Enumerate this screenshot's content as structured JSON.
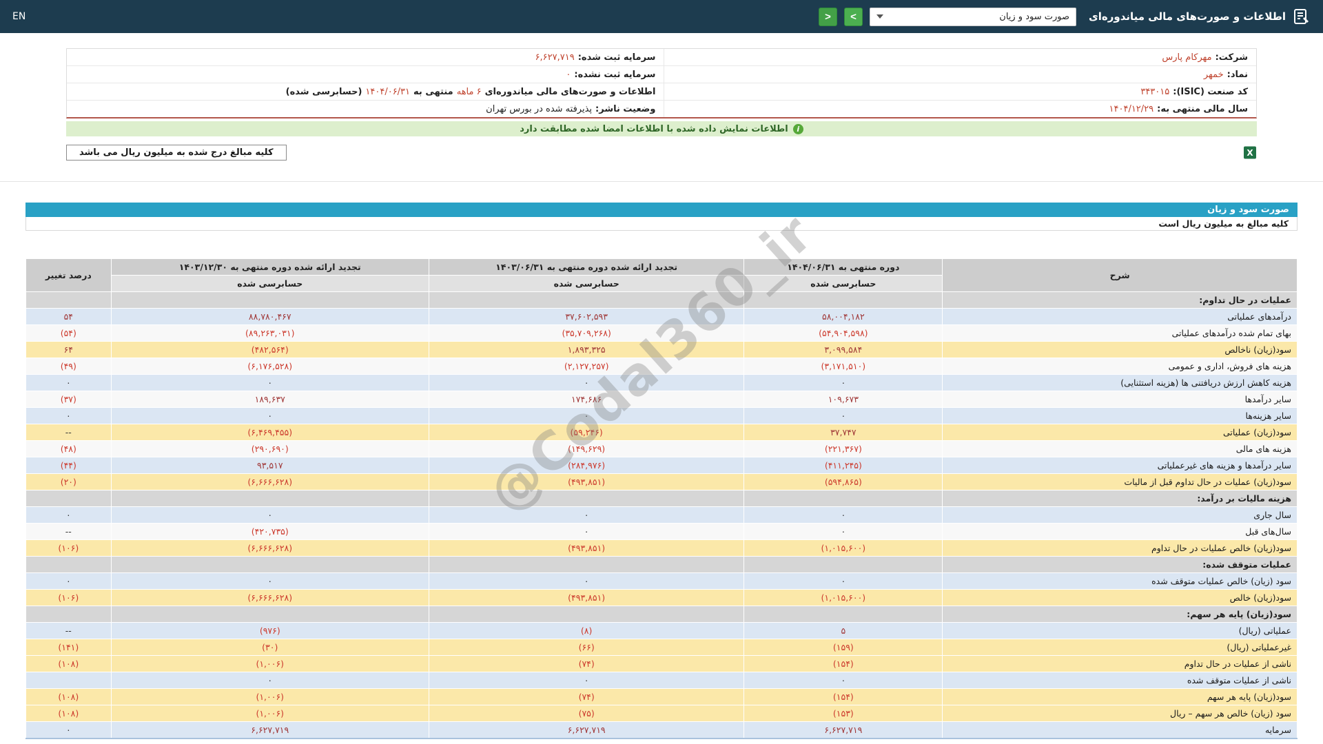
{
  "header": {
    "title": "اطلاعات و صورت‌های مالی میاندوره‌ای",
    "select_value": "صورت سود و زیان",
    "nav_buttons": {
      "forward": ">",
      "back": "<"
    },
    "lang": "EN"
  },
  "icons": {
    "info": "i",
    "excel": "X"
  },
  "company": {
    "rows": [
      {
        "label": "شرکت:",
        "value": "مهرکام پارس"
      },
      {
        "label": "نماد:",
        "value": "خمهر"
      },
      {
        "label": "کد صنعت (ISIC):",
        "value": "۳۴۳۰۱۵"
      },
      {
        "label": "سال مالی منتهی به:",
        "value": "۱۴۰۴/۱۲/۲۹"
      }
    ],
    "capital_rows": [
      {
        "label": "سرمایه ثبت شده:",
        "value": "۶,۶۲۷,۷۱۹"
      },
      {
        "label": "سرمایه ثبت نشده:",
        "value": "۰"
      }
    ],
    "period_line": {
      "prefix": "اطلاعات و صورت‌های مالی میاندوره‌ای",
      "duration": "۶ ماهه",
      "mid": "منتهی به",
      "date": "۱۴۰۴/۰۶/۳۱",
      "suffix": "(حسابرسی شده)"
    },
    "status": {
      "label": "وضعیت ناشر:",
      "value": "پذیرفته شده در بورس تهران"
    }
  },
  "notice": "اطلاعات نمایش داده شده با اطلاعات امضا شده مطابقت دارد",
  "units_note": "کلیه مبالغ درج شده به میلیون ریال می باشد",
  "statement": {
    "title": "صورت سود و زیان",
    "units": "کلیه مبالغ به میلیون ریال است"
  },
  "watermark": "@Codal360_ir",
  "table": {
    "col_desc": "شرح",
    "col_change": "درصد تغییر",
    "periods": [
      {
        "title": "دوره منتهی به ۱۴۰۴/۰۶/۳۱",
        "sub": "حسابرسی شده"
      },
      {
        "title": "تجدید ارائه شده دوره منتهی به ۱۴۰۳/۰۶/۳۱",
        "sub": "حسابرسی شده"
      },
      {
        "title": "تجدید ارائه شده دوره منتهی به ۱۴۰۳/۱۲/۳۰",
        "sub": "حسابرسی شده"
      }
    ],
    "rows": [
      {
        "label": "عملیات در حال تداوم:",
        "style": "section"
      },
      {
        "label": "درآمدهای عملیاتی",
        "style": "blue",
        "v": [
          "۵۸,۰۰۴,۱۸۲",
          "۳۷,۶۰۲,۵۹۳",
          "۸۸,۷۸۰,۴۶۷"
        ],
        "pct": "۵۴"
      },
      {
        "label": "بهای تمام شده درآمدهای عملیاتی",
        "style": "white",
        "v": [
          "(۵۴,۹۰۴,۵۹۸)",
          "(۳۵,۷۰۹,۲۶۸)",
          "(۸۹,۲۶۳,۰۳۱)"
        ],
        "pct": "(۵۴)"
      },
      {
        "label": "سود(زیان) ناخالص",
        "style": "yellow",
        "v": [
          "۳,۰۹۹,۵۸۴",
          "۱,۸۹۳,۳۲۵",
          "(۴۸۲,۵۶۴)"
        ],
        "pct": "۶۴"
      },
      {
        "label": "هزینه های فروش، اداری و عمومی",
        "style": "white",
        "v": [
          "(۳,۱۷۱,۵۱۰)",
          "(۲,۱۲۷,۲۵۷)",
          "(۶,۱۷۶,۵۲۸)"
        ],
        "pct": "(۴۹)"
      },
      {
        "label": "هزینه کاهش ارزش دریافتنی ها (هزینه استثنایی)",
        "style": "blue",
        "v": [
          "۰",
          "۰",
          "۰"
        ],
        "pct": "۰"
      },
      {
        "label": "سایر درآمدها",
        "style": "white",
        "v": [
          "۱۰۹,۶۷۳",
          "۱۷۴,۶۸۶",
          "۱۸۹,۶۳۷"
        ],
        "pct": "(۳۷)"
      },
      {
        "label": "سایر هزینه‌ها",
        "style": "blue",
        "v": [
          "۰",
          "۰",
          "۰"
        ],
        "pct": "۰"
      },
      {
        "label": "سود(زیان) عملیاتی",
        "style": "yellow",
        "v": [
          "۳۷,۷۴۷",
          "(۵۹,۲۴۶)",
          "(۶,۴۶۹,۴۵۵)"
        ],
        "pct": "--"
      },
      {
        "label": "هزینه های مالی",
        "style": "white",
        "v": [
          "(۲۲۱,۳۶۷)",
          "(۱۴۹,۶۲۹)",
          "(۲۹۰,۶۹۰)"
        ],
        "pct": "(۴۸)"
      },
      {
        "label": "سایر درآمدها و هزینه های غیرعملیاتی",
        "style": "blue",
        "v": [
          "(۴۱۱,۲۴۵)",
          "(۲۸۴,۹۷۶)",
          "۹۳,۵۱۷"
        ],
        "pct": "(۴۴)"
      },
      {
        "label": "سود(زیان) عملیات در حال تداوم قبل از مالیات",
        "style": "yellow",
        "v": [
          "(۵۹۴,۸۶۵)",
          "(۴۹۳,۸۵۱)",
          "(۶,۶۶۶,۶۲۸)"
        ],
        "pct": "(۲۰)"
      },
      {
        "label": "هزینه مالیات بر درآمد:",
        "style": "section"
      },
      {
        "label": "سال جاری",
        "style": "blue",
        "v": [
          "۰",
          "۰",
          "۰"
        ],
        "pct": "۰"
      },
      {
        "label": "سال‌های قبل",
        "style": "white",
        "v": [
          "۰",
          "۰",
          "(۴۲۰,۷۳۵)"
        ],
        "pct": "--"
      },
      {
        "label": "سود(زیان) خالص عملیات در حال تداوم",
        "style": "yellow",
        "v": [
          "(۱,۰۱۵,۶۰۰)",
          "(۴۹۳,۸۵۱)",
          "(۶,۶۶۶,۶۲۸)"
        ],
        "pct": "(۱۰۶)"
      },
      {
        "label": "عملیات متوقف شده:",
        "style": "section"
      },
      {
        "label": "سود (زیان) خالص عملیات متوقف شده",
        "style": "blue",
        "v": [
          "۰",
          "۰",
          "۰"
        ],
        "pct": "۰"
      },
      {
        "label": "سود(زیان) خالص",
        "style": "yellow",
        "v": [
          "(۱,۰۱۵,۶۰۰)",
          "(۴۹۳,۸۵۱)",
          "(۶,۶۶۶,۶۲۸)"
        ],
        "pct": "(۱۰۶)"
      },
      {
        "label": "سود(زیان) پایه هر سهم:",
        "style": "section"
      },
      {
        "label": "عملیاتی (ریال)",
        "style": "blue",
        "v": [
          "۵",
          "(۸)",
          "(۹۷۶)"
        ],
        "pct": "--"
      },
      {
        "label": "غیرعملیاتی (ریال)",
        "style": "yellow",
        "v": [
          "(۱۵۹)",
          "(۶۶)",
          "(۳۰)"
        ],
        "pct": "(۱۴۱)"
      },
      {
        "label": "ناشی از عملیات در حال تداوم",
        "style": "yellow",
        "v": [
          "(۱۵۴)",
          "(۷۴)",
          "(۱,۰۰۶)"
        ],
        "pct": "(۱۰۸)"
      },
      {
        "label": "ناشی از عملیات متوقف شده",
        "style": "blue",
        "v": [
          "۰",
          "۰",
          "۰"
        ],
        "pct": ""
      },
      {
        "label": "سود(زیان) پایه هر سهم",
        "style": "yellow",
        "v": [
          "(۱۵۴)",
          "(۷۴)",
          "(۱,۰۰۶)"
        ],
        "pct": "(۱۰۸)"
      },
      {
        "label": "سود (زیان) خالص هر سهم – ریال",
        "style": "yellow",
        "v": [
          "(۱۵۳)",
          "(۷۵)",
          "(۱,۰۰۶)"
        ],
        "pct": "(۱۰۸)"
      },
      {
        "label": "سرمایه",
        "style": "blue",
        "v": [
          "۶,۶۲۷,۷۱۹",
          "۶,۶۲۷,۷۱۹",
          "۶,۶۲۷,۷۱۹"
        ],
        "pct": "۰"
      }
    ]
  }
}
